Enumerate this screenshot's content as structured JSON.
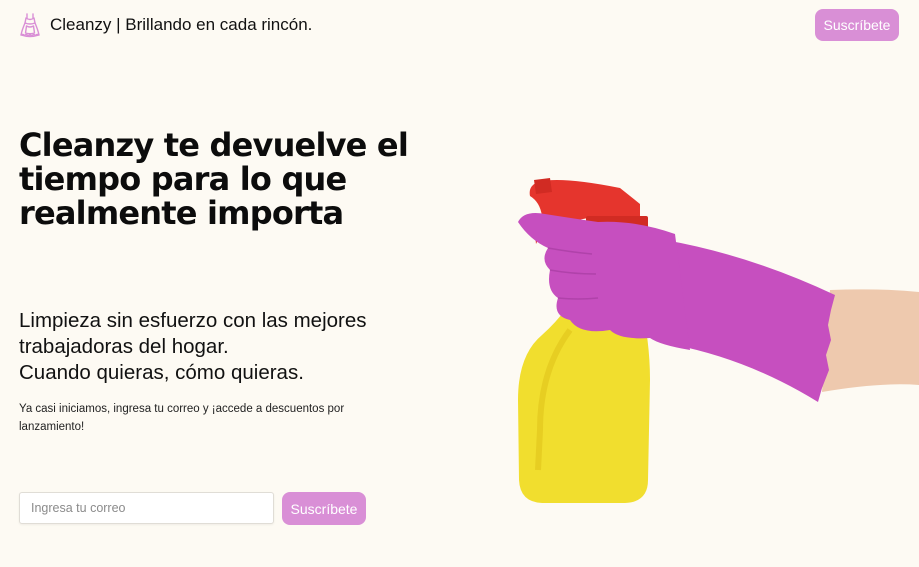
{
  "header": {
    "brand_title": "Cleanzy | Brillando en cada rincón.",
    "subscribe_label": "Suscríbete"
  },
  "hero": {
    "title": "Cleanzy te devuelve el tiempo para lo que realmente importa",
    "subtitle_line1": "Limpieza sin esfuerzo con las mejores",
    "subtitle_line2": "trabajadoras del hogar.",
    "subtitle_line3": "Cuando quieras, cómo quieras.",
    "note": "Ya casi iniciamos, ingresa tu correo y ¡accede a descuentos por lanzamiento!"
  },
  "signup": {
    "email_placeholder": "Ingresa tu correo",
    "email_value": "",
    "subscribe_label": "Suscríbete"
  },
  "icons": {
    "brand": "maid-dress-icon",
    "hero_image": "gloved-hand-spray-bottle"
  },
  "colors": {
    "accent": "#d98fd6",
    "background": "#fdfaf3",
    "glove": "#c64fbf",
    "bottle": "#f1de2e",
    "trigger": "#e5352d",
    "skin": "#eec9ae"
  }
}
